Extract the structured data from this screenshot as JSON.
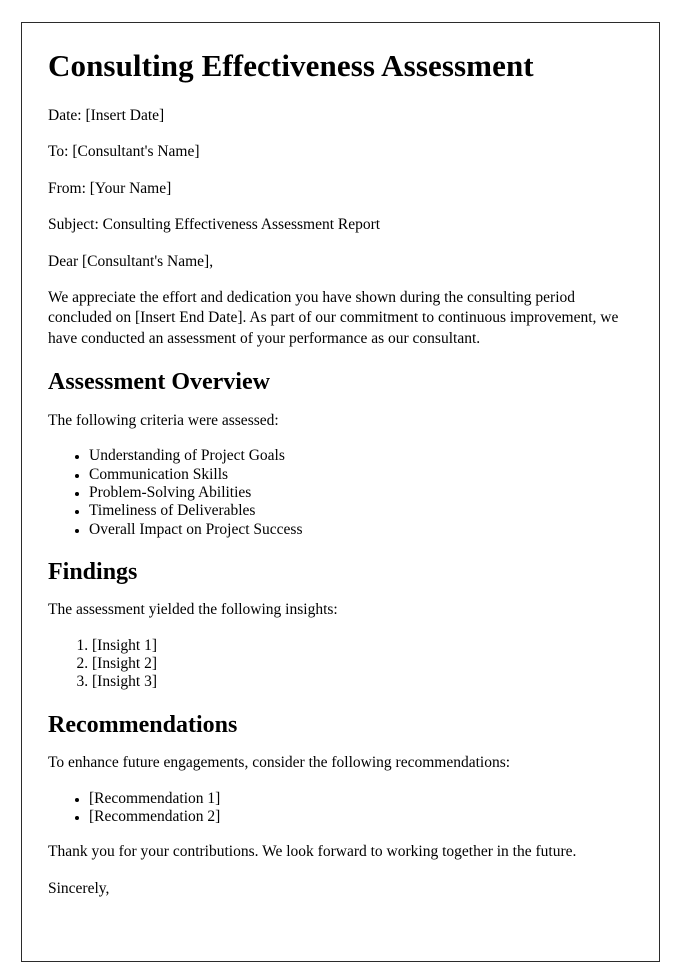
{
  "document": {
    "title": "Consulting Effectiveness Assessment",
    "header_lines": [
      "Date: [Insert Date]",
      "To: [Consultant's Name]",
      "From: [Your Name]",
      "Subject: Consulting Effectiveness Assessment Report"
    ],
    "salutation": "Dear [Consultant's Name],",
    "intro_paragraph": "We appreciate the effort and dedication you have shown during the consulting period concluded on [Insert End Date]. As part of our commitment to continuous improvement, we have conducted an assessment of your performance as our consultant.",
    "sections": [
      {
        "heading": "Assessment Overview",
        "lead_in": "The following criteria were assessed:",
        "list_type": "bullet",
        "items": [
          "Understanding of Project Goals",
          "Communication Skills",
          "Problem-Solving Abilities",
          "Timeliness of Deliverables",
          "Overall Impact on Project Success"
        ]
      },
      {
        "heading": "Findings",
        "lead_in": "The assessment yielded the following insights:",
        "list_type": "number",
        "items": [
          "[Insight 1]",
          "[Insight 2]",
          "[Insight 3]"
        ]
      },
      {
        "heading": "Recommendations",
        "lead_in": "To enhance future engagements, consider the following recommendations:",
        "list_type": "bullet",
        "items": [
          "[Recommendation 1]",
          "[Recommendation 2]"
        ]
      }
    ],
    "closing_paragraph": "Thank you for your contributions. We look forward to working together in the future.",
    "signoff": "Sincerely,"
  },
  "colors": {
    "page_border": "#2b2b2b",
    "text": "#000000",
    "background": "#ffffff"
  }
}
